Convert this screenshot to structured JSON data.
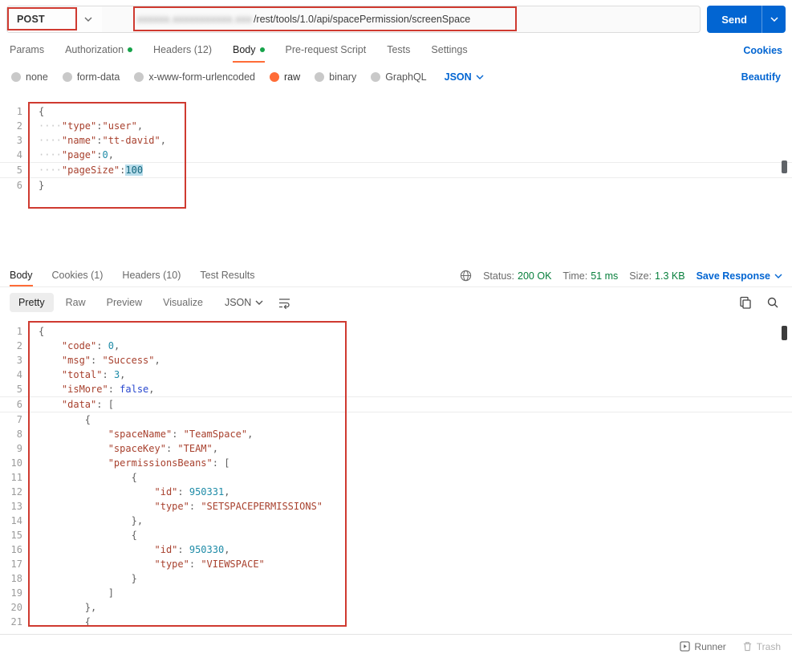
{
  "url_bar": {
    "method": "POST",
    "url_redacted_mask": "xxxxxx.xxxxxxxxxxx.xxx",
    "url_visible": "/rest/tools/1.0/api/spacePermission/screenSpace",
    "send": "Send"
  },
  "request_tabs": {
    "items": [
      {
        "label": "Params"
      },
      {
        "label": "Authorization",
        "dot": true
      },
      {
        "label": "Headers (12)"
      },
      {
        "label": "Body",
        "dot": true,
        "active": true
      },
      {
        "label": "Pre-request Script"
      },
      {
        "label": "Tests"
      },
      {
        "label": "Settings"
      }
    ],
    "cookies": "Cookies"
  },
  "body_mode": {
    "options": [
      "none",
      "form-data",
      "x-www-form-urlencoded",
      "raw",
      "binary",
      "GraphQL"
    ],
    "selected": "raw",
    "language": "JSON",
    "beautify": "Beautify"
  },
  "request_editor": {
    "current_line": 5,
    "lines": [
      [
        [
          "pun",
          "{"
        ]
      ],
      [
        [
          "ws",
          "····"
        ],
        [
          "str",
          "\"type\""
        ],
        [
          "pun",
          ":"
        ],
        [
          "str",
          "\"user\""
        ],
        [
          "pun",
          ","
        ]
      ],
      [
        [
          "ws",
          "····"
        ],
        [
          "str",
          "\"name\""
        ],
        [
          "pun",
          ":"
        ],
        [
          "str",
          "\"tt-david\""
        ],
        [
          "pun",
          ","
        ]
      ],
      [
        [
          "ws",
          "····"
        ],
        [
          "str",
          "\"page\""
        ],
        [
          "pun",
          ":"
        ],
        [
          "num",
          "0"
        ],
        [
          "pun",
          ","
        ]
      ],
      [
        [
          "ws",
          "····"
        ],
        [
          "str",
          "\"pageSize\""
        ],
        [
          "pun",
          ":"
        ],
        [
          "numsel",
          "100"
        ]
      ],
      [
        [
          "pun",
          "}"
        ]
      ]
    ]
  },
  "response_header": {
    "tabs": [
      {
        "label": "Body",
        "active": true
      },
      {
        "label": "Cookies (1)"
      },
      {
        "label": "Headers (10)"
      },
      {
        "label": "Test Results"
      }
    ],
    "status": [
      {
        "label": "Status:",
        "value": "200 OK"
      },
      {
        "label": "Time:",
        "value": "51 ms"
      },
      {
        "label": "Size:",
        "value": "1.3 KB"
      }
    ],
    "save_response": "Save Response"
  },
  "response_toolbar": {
    "views": [
      "Pretty",
      "Raw",
      "Preview",
      "Visualize"
    ],
    "active_view": "Pretty",
    "language": "JSON"
  },
  "response_editor": {
    "current_line": 6,
    "lines": [
      [
        [
          "pun",
          "{"
        ]
      ],
      [
        [
          "sp",
          "    "
        ],
        [
          "str",
          "\"code\""
        ],
        [
          "pun",
          ": "
        ],
        [
          "num",
          "0"
        ],
        [
          "pun",
          ","
        ]
      ],
      [
        [
          "sp",
          "    "
        ],
        [
          "str",
          "\"msg\""
        ],
        [
          "pun",
          ": "
        ],
        [
          "str",
          "\"Success\""
        ],
        [
          "pun",
          ","
        ]
      ],
      [
        [
          "sp",
          "    "
        ],
        [
          "str",
          "\"total\""
        ],
        [
          "pun",
          ": "
        ],
        [
          "num",
          "3"
        ],
        [
          "pun",
          ","
        ]
      ],
      [
        [
          "sp",
          "    "
        ],
        [
          "str",
          "\"isMore\""
        ],
        [
          "pun",
          ": "
        ],
        [
          "kw",
          "false"
        ],
        [
          "pun",
          ","
        ]
      ],
      [
        [
          "sp",
          "    "
        ],
        [
          "str",
          "\"data\""
        ],
        [
          "pun",
          ": ["
        ]
      ],
      [
        [
          "sp",
          "        "
        ],
        [
          "pun",
          "{"
        ]
      ],
      [
        [
          "sp",
          "            "
        ],
        [
          "str",
          "\"spaceName\""
        ],
        [
          "pun",
          ": "
        ],
        [
          "str",
          "\"TeamSpace\""
        ],
        [
          "pun",
          ","
        ]
      ],
      [
        [
          "sp",
          "            "
        ],
        [
          "str",
          "\"spaceKey\""
        ],
        [
          "pun",
          ": "
        ],
        [
          "str",
          "\"TEAM\""
        ],
        [
          "pun",
          ","
        ]
      ],
      [
        [
          "sp",
          "            "
        ],
        [
          "str",
          "\"permissionsBeans\""
        ],
        [
          "pun",
          ": ["
        ]
      ],
      [
        [
          "sp",
          "                "
        ],
        [
          "pun",
          "{"
        ]
      ],
      [
        [
          "sp",
          "                    "
        ],
        [
          "str",
          "\"id\""
        ],
        [
          "pun",
          ": "
        ],
        [
          "num",
          "950331"
        ],
        [
          "pun",
          ","
        ]
      ],
      [
        [
          "sp",
          "                    "
        ],
        [
          "str",
          "\"type\""
        ],
        [
          "pun",
          ": "
        ],
        [
          "str",
          "\"SETSPACEPERMISSIONS\""
        ]
      ],
      [
        [
          "sp",
          "                "
        ],
        [
          "pun",
          "},"
        ]
      ],
      [
        [
          "sp",
          "                "
        ],
        [
          "pun",
          "{"
        ]
      ],
      [
        [
          "sp",
          "                    "
        ],
        [
          "str",
          "\"id\""
        ],
        [
          "pun",
          ": "
        ],
        [
          "num",
          "950330"
        ],
        [
          "pun",
          ","
        ]
      ],
      [
        [
          "sp",
          "                    "
        ],
        [
          "str",
          "\"type\""
        ],
        [
          "pun",
          ": "
        ],
        [
          "str",
          "\"VIEWSPACE\""
        ]
      ],
      [
        [
          "sp",
          "                "
        ],
        [
          "pun",
          "}"
        ]
      ],
      [
        [
          "sp",
          "            "
        ],
        [
          "pun",
          "]"
        ]
      ],
      [
        [
          "sp",
          "        "
        ],
        [
          "pun",
          "},"
        ]
      ],
      [
        [
          "sp",
          "        "
        ],
        [
          "pun",
          "{"
        ]
      ]
    ]
  },
  "footer": {
    "runner": "Runner",
    "trash": "Trash"
  },
  "colors": {
    "accent_orange": "#ff6c37",
    "link_blue": "#0265d2",
    "success_green": "#077f3c",
    "annotation_red": "#cf3a30",
    "code_string": "#a8412e",
    "code_number": "#1e8ba7",
    "code_keyword": "#2948cf"
  }
}
